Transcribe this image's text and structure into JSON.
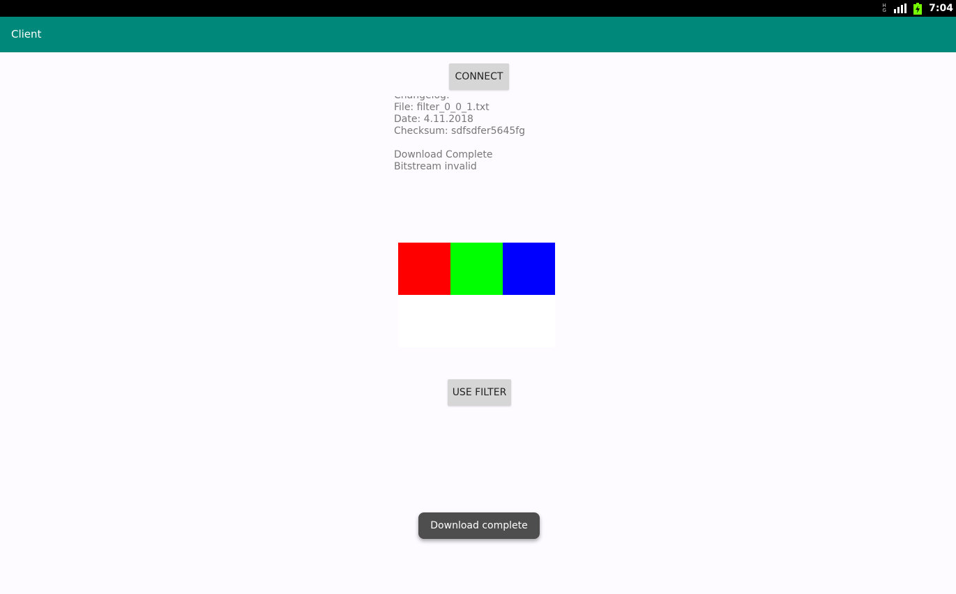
{
  "status_bar": {
    "network_type_top": "H",
    "network_type_bottom": "G",
    "signal_icon": "signal-bars-icon",
    "battery_icon": "battery-charging-icon",
    "time": "7:04",
    "battery_color": "#76ff03"
  },
  "app_bar": {
    "title": "Client",
    "color": "#00897b"
  },
  "connect_button": {
    "label": "CONNECT"
  },
  "log": {
    "lines": [
      "Changelog:",
      "File: filter_0_0_1.txt",
      "Date: 4.11.2018",
      "Checksum: sdfsdfer5645fg",
      "",
      "Download Complete",
      "Bitstream invalid"
    ]
  },
  "swatches": [
    {
      "name": "red",
      "color": "#ff0000"
    },
    {
      "name": "green",
      "color": "#00ff00"
    },
    {
      "name": "blue",
      "color": "#0000ff"
    }
  ],
  "filter_button": {
    "label": "USE FILTER"
  },
  "toast": {
    "message": "Download complete"
  }
}
